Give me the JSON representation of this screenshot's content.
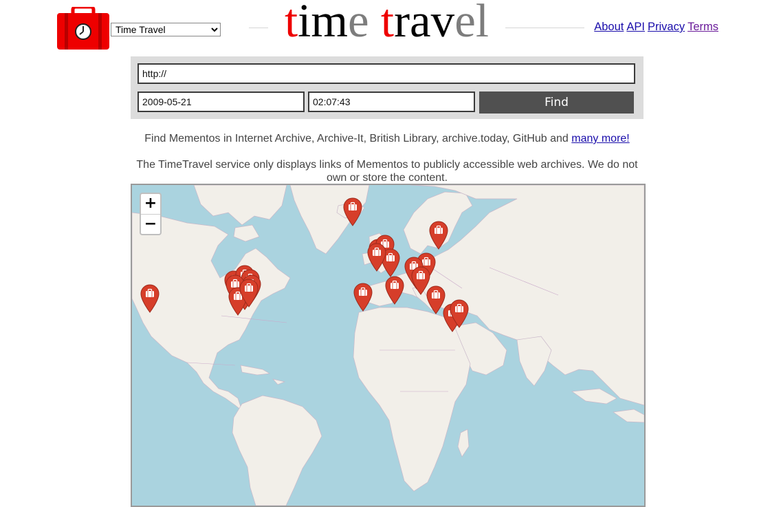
{
  "header": {
    "logo_alt": "Time Travel",
    "version_select": {
      "selected": "Time Travel",
      "options": [
        "Time Travel"
      ]
    },
    "brand": [
      {
        "text": "t",
        "color": "red"
      },
      {
        "text": "im",
        "color": "black"
      },
      {
        "text": "e",
        "color": "grey"
      },
      {
        "text": " ",
        "color": "black"
      },
      {
        "text": "t",
        "color": "red"
      },
      {
        "text": "rav",
        "color": "black"
      },
      {
        "text": "el",
        "color": "grey"
      }
    ],
    "nav": [
      {
        "label": "About",
        "visited": false
      },
      {
        "label": "API",
        "visited": false
      },
      {
        "label": "Privacy",
        "visited": false
      },
      {
        "label": "Terms",
        "visited": true
      }
    ]
  },
  "search": {
    "url_value": "http://",
    "date_value": "2009-05-21",
    "time_value": "02:07:43",
    "find_label": "Find"
  },
  "info": {
    "archives_text": "Find Mementos in Internet Archive, Archive-It, British Library, archive.today, GitHub and ",
    "archives_link": "many more!",
    "disclaimer": "The TimeTravel service only displays links of Mementos to publicly accessible web archives. We do not own or store the content."
  },
  "map": {
    "zoom_in_label": "+",
    "zoom_out_label": "−",
    "marker_count": 25,
    "colors": {
      "water": "#aad3df",
      "land": "#f2efe9",
      "marker": "#d63e2a",
      "accent_red": "#ee0000"
    }
  }
}
